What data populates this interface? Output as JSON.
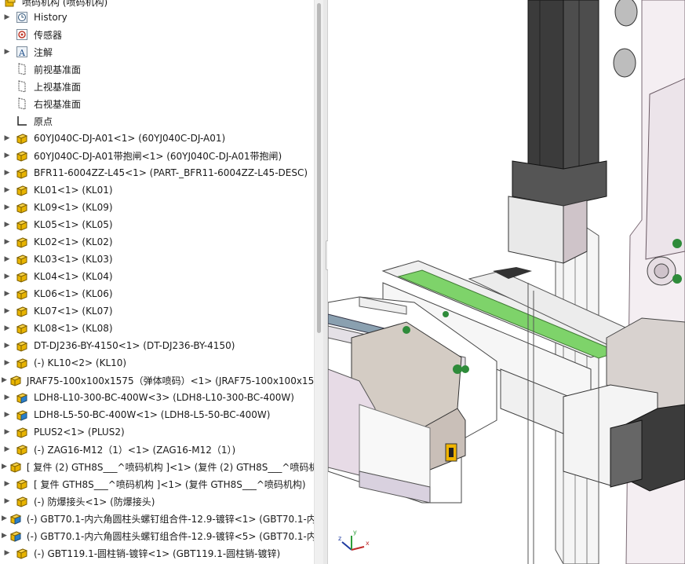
{
  "tree": {
    "root_label": "喷码机构 (喷码机构)",
    "items": [
      {
        "label": "History",
        "icon": "history-icon",
        "expandable": true
      },
      {
        "label": "传感器",
        "icon": "sensor-icon",
        "expandable": false
      },
      {
        "label": "注解",
        "icon": "annotation-icon",
        "expandable": true
      },
      {
        "label": "前视基准面",
        "icon": "plane-icon",
        "expandable": false
      },
      {
        "label": "上视基准面",
        "icon": "plane-icon",
        "expandable": false
      },
      {
        "label": "右视基准面",
        "icon": "plane-icon",
        "expandable": false
      },
      {
        "label": "原点",
        "icon": "origin-icon",
        "expandable": false
      },
      {
        "label": "60YJ040C-DJ-A01<1> (60YJ040C-DJ-A01)",
        "icon": "part-icon",
        "expandable": true
      },
      {
        "label": "60YJ040C-DJ-A01带抱闸<1> (60YJ040C-DJ-A01带抱闸)",
        "icon": "part-icon",
        "expandable": true
      },
      {
        "label": "BFR11-6004ZZ-L45<1> (PART-_BFR11-6004ZZ-L45-DESC)",
        "icon": "part-icon",
        "expandable": true
      },
      {
        "label": "KL01<1> (KL01)",
        "icon": "part-icon",
        "expandable": true
      },
      {
        "label": "KL09<1> (KL09)",
        "icon": "part-icon",
        "expandable": true
      },
      {
        "label": "KL05<1> (KL05)",
        "icon": "part-icon",
        "expandable": true
      },
      {
        "label": "KL02<1> (KL02)",
        "icon": "part-icon",
        "expandable": true
      },
      {
        "label": "KL03<1> (KL03)",
        "icon": "part-icon",
        "expandable": true
      },
      {
        "label": "KL04<1> (KL04)",
        "icon": "part-icon",
        "expandable": true
      },
      {
        "label": "KL06<1> (KL06)",
        "icon": "part-icon",
        "expandable": true
      },
      {
        "label": "KL07<1> (KL07)",
        "icon": "part-icon",
        "expandable": true
      },
      {
        "label": "KL08<1> (KL08)",
        "icon": "part-icon",
        "expandable": true
      },
      {
        "label": "DT-DJ236-BY-4150<1> (DT-DJ236-BY-4150)",
        "icon": "part-icon",
        "expandable": true
      },
      {
        "label": "(-) KL10<2> (KL10)",
        "icon": "part-icon",
        "expandable": true
      },
      {
        "label": "JRAF75-100x100x1575（弹体喷码）<1> (JRAF75-100x100x157",
        "icon": "part-icon",
        "expandable": true
      },
      {
        "label": "LDH8-L10-300-BC-400W<3> (LDH8-L10-300-BC-400W)",
        "icon": "assembly-icon",
        "expandable": true
      },
      {
        "label": "LDH8-L5-50-BC-400W<1> (LDH8-L5-50-BC-400W)",
        "icon": "assembly-icon",
        "expandable": true
      },
      {
        "label": "PLUS2<1> (PLUS2)",
        "icon": "part-icon",
        "expandable": true
      },
      {
        "label": "(-) ZAG16-M12（1）<1> (ZAG16-M12（1）)",
        "icon": "part-icon",
        "expandable": true
      },
      {
        "label": "[ 复件 (2) GTH8S___^喷码机构 ]<1> (复件 (2) GTH8S___^喷码机",
        "icon": "part-icon",
        "expandable": true
      },
      {
        "label": "[ 复件 GTH8S___^喷码机构 ]<1> (复件 GTH8S___^喷码机构)",
        "icon": "part-icon",
        "expandable": true
      },
      {
        "label": "(-) 防爆接头<1> (防爆接头)",
        "icon": "part-icon",
        "expandable": true
      },
      {
        "label": "(-) GBT70.1-内六角圆柱头螺钉组合件-12.9-镀锌<1> (GBT70.1-内",
        "icon": "assembly-icon",
        "expandable": true
      },
      {
        "label": "(-) GBT70.1-内六角圆柱头螺钉组合件-12.9-镀锌<5> (GBT70.1-内",
        "icon": "assembly-icon",
        "expandable": true
      },
      {
        "label": "(-) GBT119.1-圆柱销-镀锌<1> (GBT119.1-圆柱销-镀锌)",
        "icon": "part-icon",
        "expandable": true
      }
    ]
  },
  "triad": {
    "x": "x",
    "y": "y",
    "z": "z"
  },
  "colors": {
    "part": "#e8b400",
    "assembly_body": "#e8b400",
    "assembly_blue": "#2a7fc9",
    "rail_green": "#7ed36a",
    "motor_dark": "#3a3a3a"
  }
}
